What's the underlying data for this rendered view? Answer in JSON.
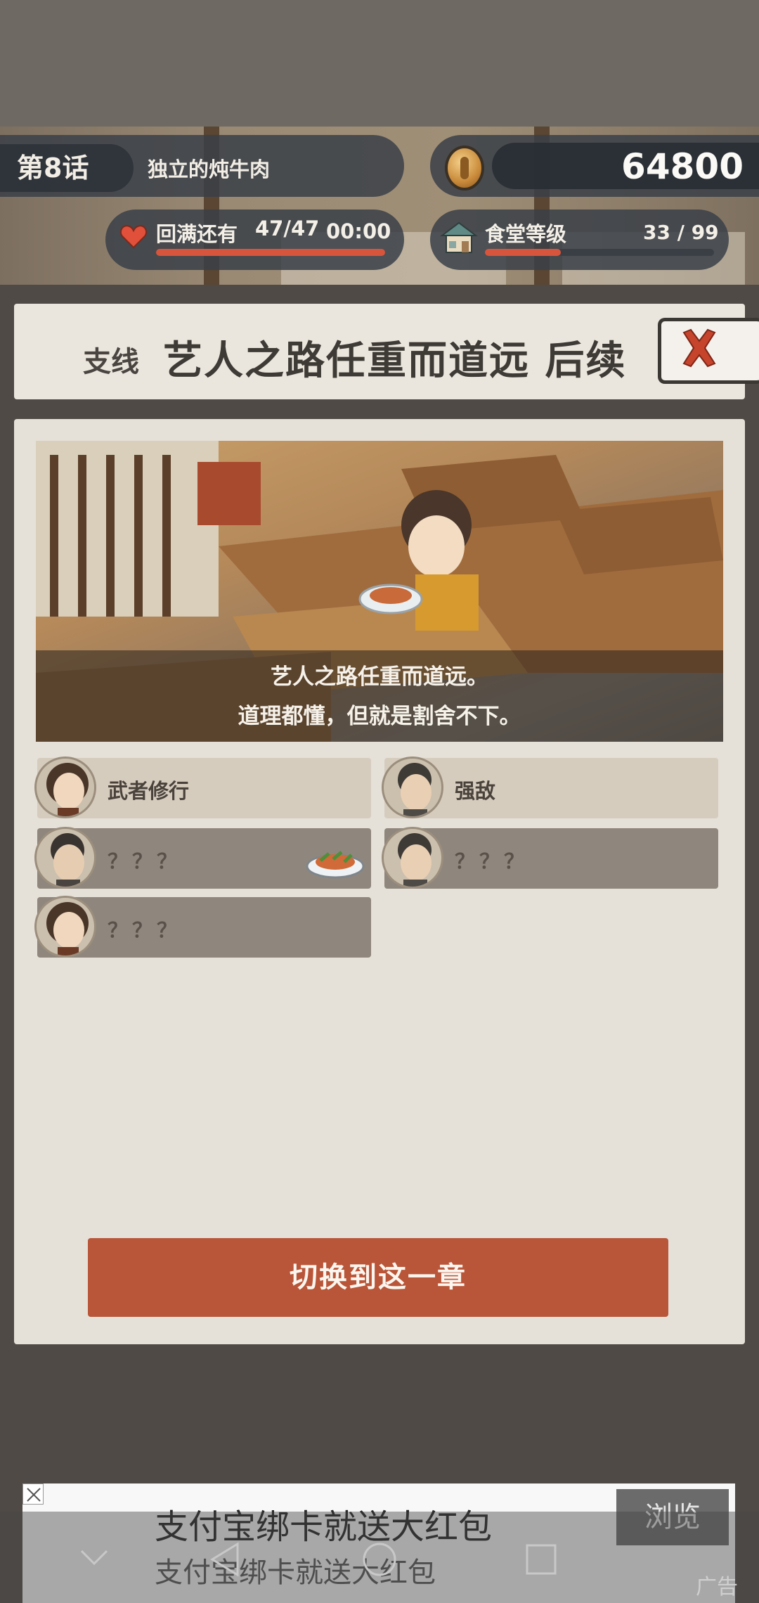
{
  "hud": {
    "chapter": "第8话",
    "chapter_name": "独立的炖牛肉",
    "coins": "64800",
    "stamina_label": "回满还有",
    "stamina_value": "47/47",
    "stamina_timer": "00:00",
    "stamina_fill": 1.0,
    "level_label": "食堂等级",
    "level_value": "33 / 99",
    "level_fill": 0.33
  },
  "title": {
    "sub": "支线",
    "main": "艺人之路任重而道远 后续"
  },
  "scene": {
    "caption_line1": "艺人之路任重而道远。",
    "caption_line2": "道理都懂，但就是割舍不下。"
  },
  "quests": [
    {
      "label": "武者修行",
      "state": "unlocked"
    },
    {
      "label": "强敌",
      "state": "unlocked"
    },
    {
      "label": "？？？",
      "state": "locked",
      "dish": true
    },
    {
      "label": "？？？",
      "state": "locked"
    },
    {
      "label": "？？？",
      "state": "locked"
    }
  ],
  "switch_button": "切换到这一章",
  "ad": {
    "line1": "支付宝绑卡就送大红包",
    "line2": "支付宝绑卡就送大红包",
    "button": "浏览",
    "mark": "广告"
  },
  "colors": {
    "accent": "#b95538",
    "card": "#e5e0d8",
    "locked": "#8f877d",
    "unlocked": "#d6ccbe"
  }
}
